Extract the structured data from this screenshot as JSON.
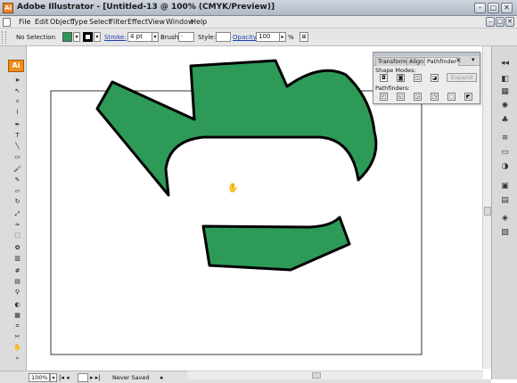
{
  "window": {
    "title": "Adobe Illustrator - [Untitled-13 @ 100% (CMYK/Preview)]",
    "app_logo": "Ai",
    "buttons": [
      "minimize",
      "maximize",
      "close"
    ]
  },
  "menu": [
    "File",
    "Edit",
    "Object",
    "Type",
    "Select",
    "Filter",
    "Effect",
    "View",
    "Window",
    "Help"
  ],
  "control_bar": {
    "selection": "No Selection",
    "fill_color": "#2e9a57",
    "stroke_color": "#000000",
    "stroke_label": "Stroke:",
    "stroke_weight": "4 pt",
    "brush_label": "Brush:",
    "style_label": "Style:",
    "opacity_label": "Opacity:",
    "opacity_value": "100",
    "opacity_unit": "%"
  },
  "toolbox": {
    "badge": "Ai",
    "tools": [
      "selection-tool",
      "direct-selection-tool",
      "magic-wand-tool",
      "lasso-tool",
      "pen-tool",
      "type-tool",
      "line-tool",
      "rectangle-tool",
      "paintbrush-tool",
      "pencil-tool",
      "eraser-tool",
      "rotate-tool",
      "scale-tool",
      "warp-tool",
      "free-transform-tool",
      "symbol-sprayer-tool",
      "column-graph-tool",
      "mesh-tool",
      "gradient-tool",
      "eyedropper-tool",
      "blend-tool",
      "live-paint-tool",
      "slice-tool",
      "scissors-tool",
      "hand-tool",
      "zoom-tool"
    ]
  },
  "canvas": {
    "shape_fill": "#2e9a57",
    "shape_stroke": "#000000"
  },
  "pathfinder_panel": {
    "tabs": [
      "Transform",
      "Align",
      "Pathfinder"
    ],
    "active_tab": "Pathfinder",
    "shape_modes_label": "Shape Modes:",
    "pathfinders_label": "Pathfinders:",
    "expand_label": "Expand"
  },
  "status": {
    "zoom": "100%",
    "message": "Never Saved"
  }
}
